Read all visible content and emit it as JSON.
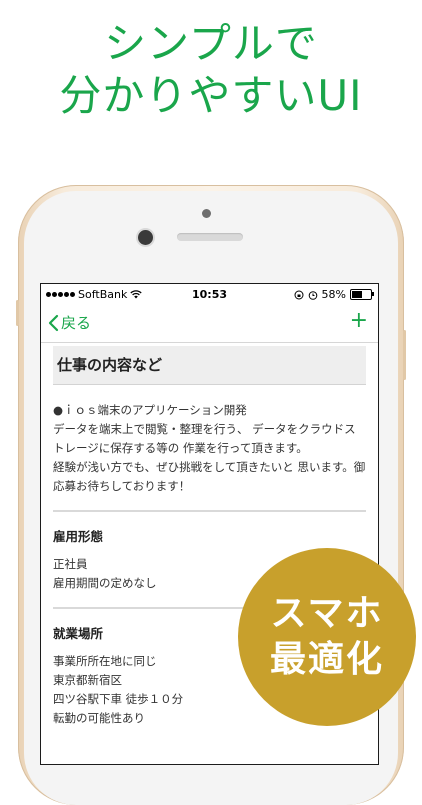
{
  "headline": {
    "line1": "シンプルで",
    "line2": "分かりやすいUI"
  },
  "status_bar": {
    "carrier": "SoftBank",
    "time": "10:53",
    "battery": "58%",
    "battery_level": 0.58
  },
  "nav": {
    "back_label": "戻る",
    "add_label": "+"
  },
  "job": {
    "section_title": "仕事の内容など",
    "description": [
      "●ｉｏｓ端末のアプリケーション開発",
      "データを端末上で閲覧・整理を行う、 データをクラウドストレージに保存する等の 作業を行って頂きます。",
      "経験が浅い方でも、ぜひ挑戦をして頂きたいと 思います。御応募お待ちしております！"
    ],
    "employment": {
      "title": "雇用形態",
      "lines": [
        "正社員",
        "雇用期間の定めなし"
      ]
    },
    "location": {
      "title": "就業場所",
      "lines": [
        "事業所所在地に同じ",
        "東京都新宿区",
        "四ツ谷駅下車 徒歩１０分",
        "転勤の可能性あり"
      ]
    }
  },
  "badge": {
    "line1": "スマホ",
    "line2": "最適化"
  },
  "colors": {
    "accent": "#1aa64b",
    "badge": "#c8a02c"
  }
}
